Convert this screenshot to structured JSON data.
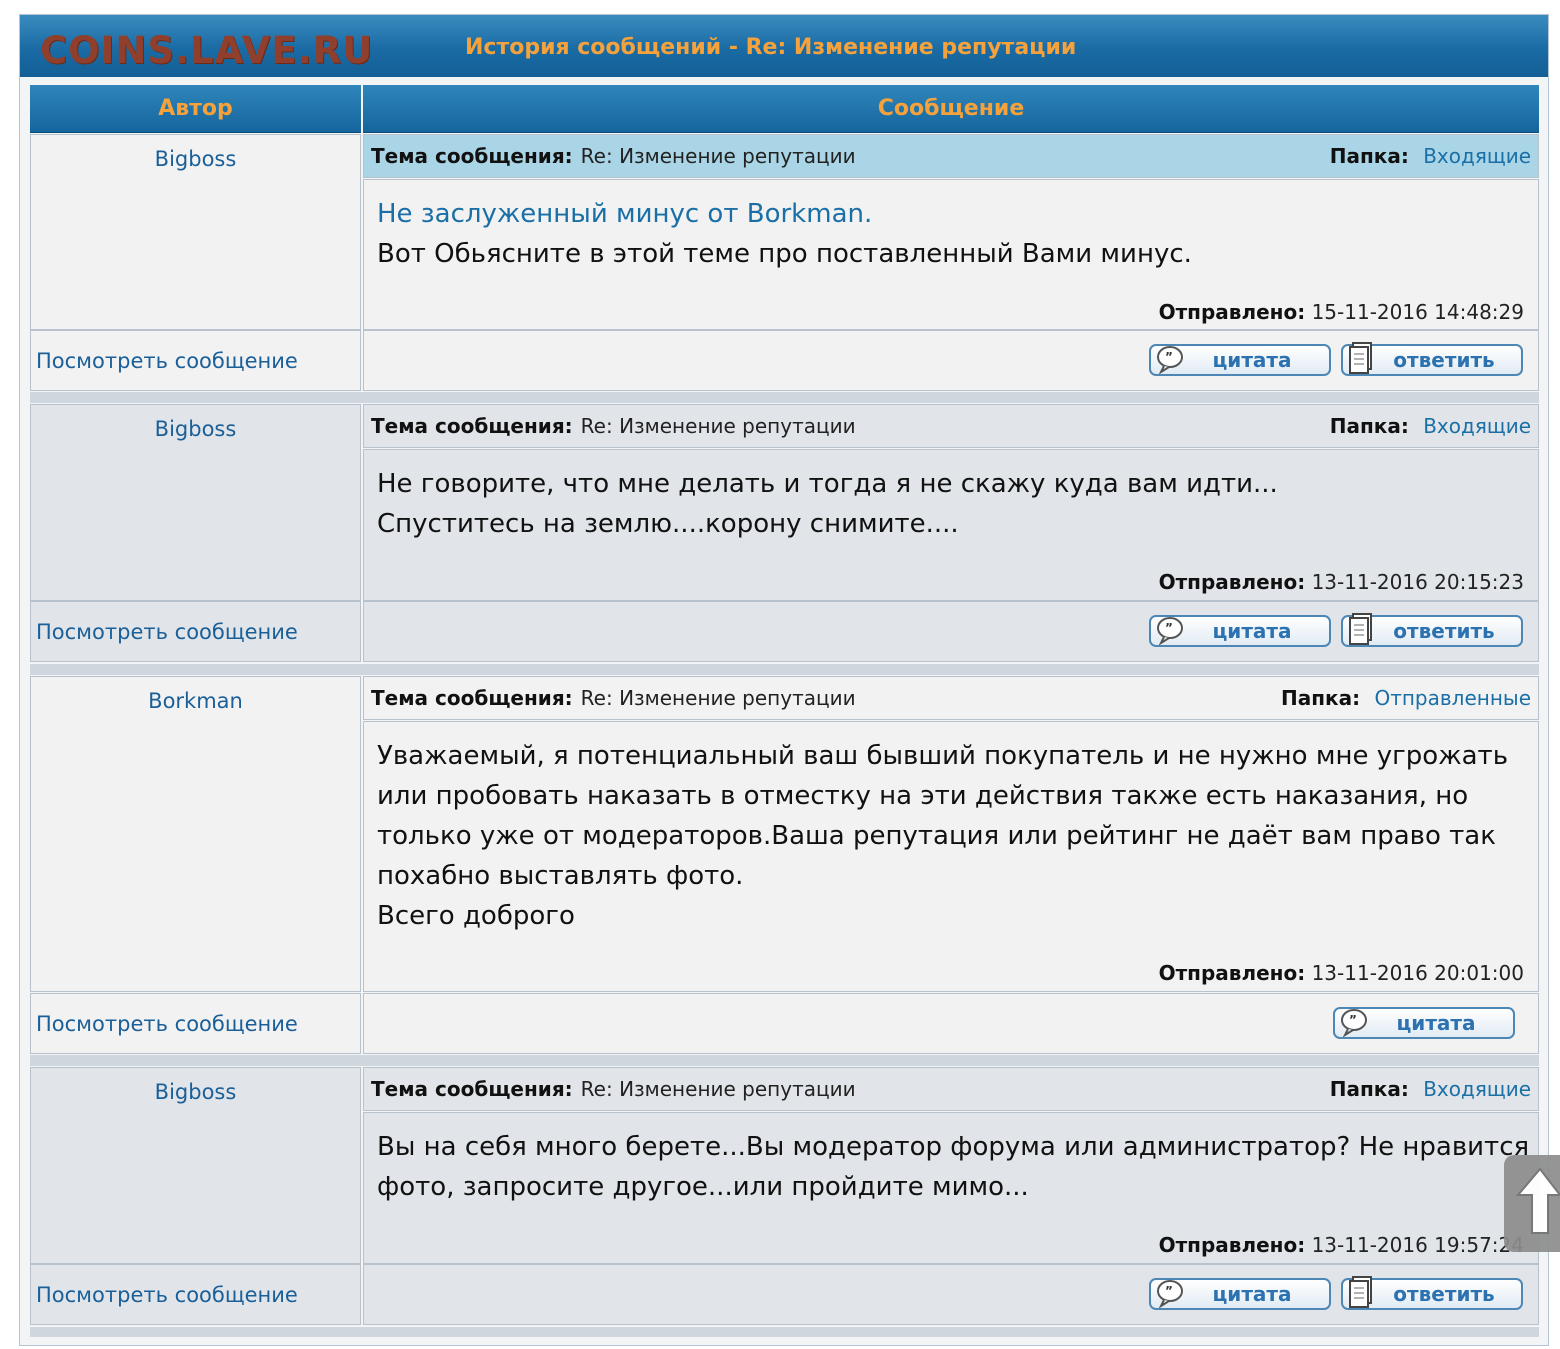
{
  "site": {
    "logo": "COINS.LAVE.RU",
    "page_title": "История сообщений - Re: Изменение репутации"
  },
  "table": {
    "col_author": "Автор",
    "col_message": "Сообщение"
  },
  "labels": {
    "subject": "Тема сообщения:",
    "folder": "Папка:",
    "sent": "Отправлено:",
    "view_message": "Посмотреть сообщение",
    "quote": "цитата",
    "reply": "ответить"
  },
  "posts": [
    {
      "author": "Bigboss",
      "subject": "Re: Изменение репутации",
      "folder": "Входящие",
      "lines": [
        "Не заслуженный минус от Borkman.",
        "Вот Обьясните в этой теме про поставленный Вами минус."
      ],
      "sent": "15-11-2016 14:48:29"
    },
    {
      "author": "Bigboss",
      "subject": "Re: Изменение репутации",
      "folder": "Входящие",
      "lines": [
        "Не говорите, что мне делать и тогда я не скажу куда вам идти...",
        "Спуститесь на землю....корону снимите...."
      ],
      "sent": "13-11-2016 20:15:23"
    },
    {
      "author": "Borkman",
      "subject": "Re: Изменение репутации",
      "folder": "Отправленные",
      "lines": [
        "Уважаемый, я потенциальный ваш бывший покупатель и не нужно мне угрожать",
        "или пробовать наказать в отместку на эти действия также есть наказания, но",
        "только уже от модераторов.Ваша репутация или рейтинг не даёт вам право так",
        "похабно выставлять фото.",
        "Всего доброго"
      ],
      "sent": "13-11-2016 20:01:00"
    },
    {
      "author": "Bigboss",
      "subject": "Re: Изменение репутации",
      "folder": "Входящие",
      "lines": [
        "Вы на себя много берете...Вы модератор форума или администратор? Не нравится",
        "фото, запросите другое...или пройдите мимо..."
      ],
      "sent": "13-11-2016 19:57:24"
    }
  ],
  "colors": {
    "header_blue": "#1a6ba4",
    "accent_orange": "#f5a23c",
    "link_blue": "#1a6fa6",
    "subject_highlight": "#aad5e6"
  }
}
